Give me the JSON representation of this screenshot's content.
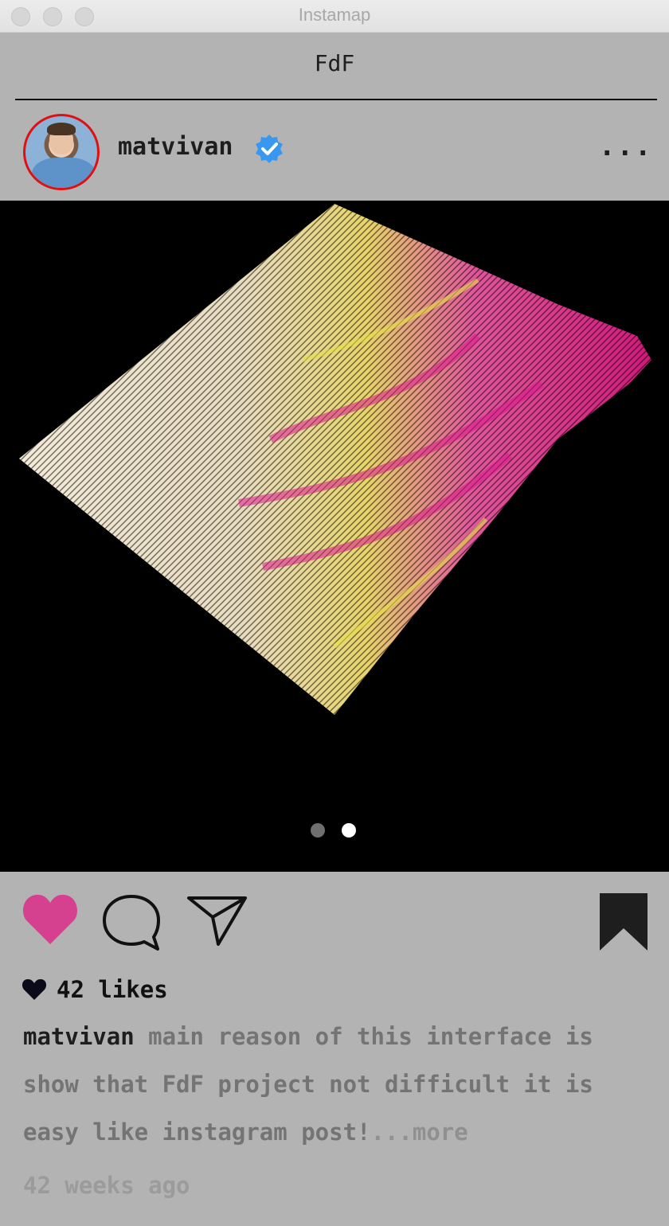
{
  "window": {
    "title": "Instamap"
  },
  "app": {
    "title": "FdF"
  },
  "post": {
    "username": "matvivan",
    "verified_icon": "verified-badge-icon",
    "menu": "...",
    "carousel": {
      "count": 2,
      "active_index": 2
    },
    "likes_text": "42 likes",
    "caption_user": "matvivan",
    "caption_text": "main reason of this interface is show that FdF project not difficult it is easy like instagram post!",
    "more_text": "...more",
    "timestamp": "42 weeks ago",
    "liked": true
  },
  "colors": {
    "like": "#d6418f",
    "verified": "#3897f0",
    "avatar_ring": "#e01010",
    "background": "#b3b3b3"
  }
}
